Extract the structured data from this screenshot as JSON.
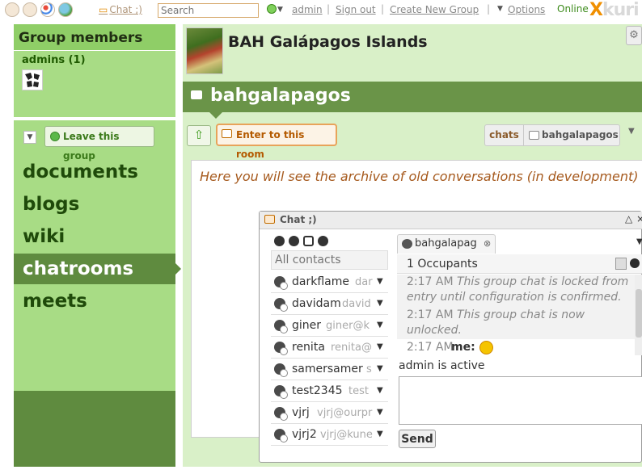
{
  "topbar": {
    "icons": [
      "home-icon",
      "apps-icon",
      "palette-icon",
      "globe-icon"
    ],
    "chat_link": "Chat ;)",
    "search_placeholder": "Search",
    "status_icon": "status-online-icon",
    "user_link": "admin",
    "signout_link": "Sign out",
    "create_group_link": "Create New Group",
    "options_link": "Options",
    "separators": [
      "|",
      "|",
      "|"
    ],
    "online_status": "Online",
    "logo": "kuri",
    "logo_prefix": "X"
  },
  "sidebar": {
    "group_members_title": "Group members",
    "admins_label": "admins (1)",
    "leave_button": "Leave this group",
    "nav": [
      {
        "label": "documents"
      },
      {
        "label": "blogs"
      },
      {
        "label": "wiki"
      },
      {
        "label": "chatrooms",
        "active": true
      },
      {
        "label": "meets"
      }
    ]
  },
  "group": {
    "title": "BAH Galápagos Islands"
  },
  "room": {
    "title": "bahgalapagos",
    "enter_button": "Enter to this room",
    "breadcrumb": [
      "chats",
      "bahgalapagos"
    ],
    "archive_note": "Here you will see the archive of old conversations (in development)"
  },
  "chat": {
    "window_title": "Chat ;)",
    "contacts_placeholder": "All contacts",
    "contacts": [
      {
        "name": "darkflame",
        "alias": "dar"
      },
      {
        "name": "davidam",
        "alias": "david"
      },
      {
        "name": "giner",
        "alias": "giner@k"
      },
      {
        "name": "renita",
        "alias": "renita@"
      },
      {
        "name": "samersamer",
        "alias": "s"
      },
      {
        "name": "test2345",
        "alias": "test"
      },
      {
        "name": "vjrj",
        "alias": "vjrj@ourpr"
      },
      {
        "name": "vjrj2",
        "alias": "vjrj@kune"
      }
    ],
    "room_tab": "bahgalapag",
    "occupants": "1 Occupants",
    "messages": [
      {
        "time": "2:17 AM",
        "text": "This group chat is locked from entry until configuration is confirmed."
      },
      {
        "time": "2:17 AM",
        "text": "This group chat is now unlocked."
      }
    ],
    "my_message": {
      "time": "2:17 AM",
      "sender": "me:",
      "emoticon": "smiley-tongue-icon"
    },
    "status_line": "admin is active",
    "send_button": "Send",
    "colors": {
      "accent": "#e8a35a",
      "sidebar": "#a8dc85",
      "active": "#5f8b3f"
    }
  }
}
